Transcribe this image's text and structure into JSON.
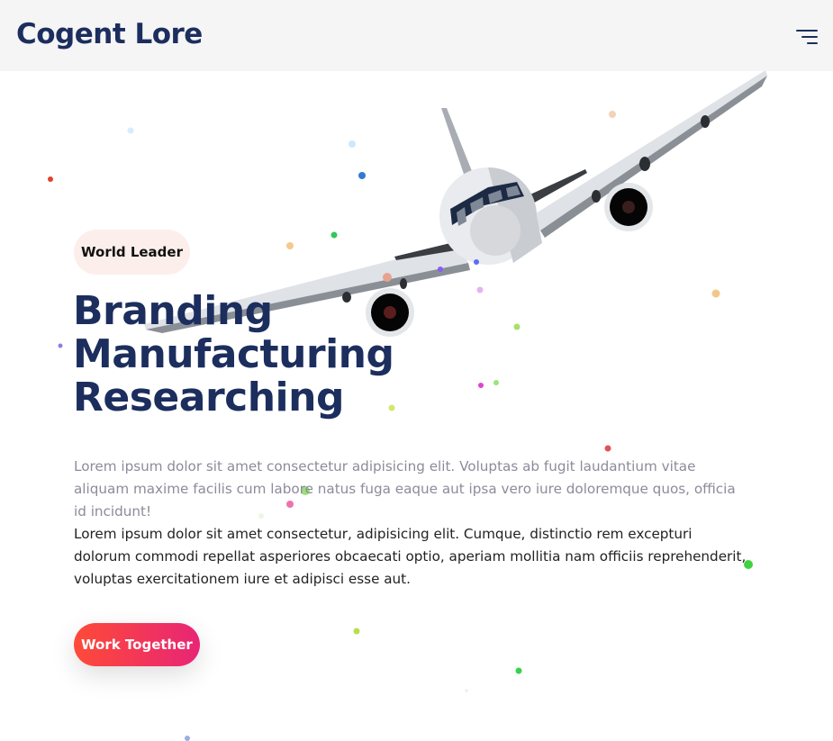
{
  "header": {
    "logo_text": "Cogent Lore",
    "menu_icon": "hamburger-menu-icon"
  },
  "hero": {
    "badge_text": "World Leader",
    "headline_lines": [
      "Branding",
      "Manufacturing",
      "Researching"
    ],
    "paragraph_1": "Lorem ipsum dolor sit amet consectetur adipisicing elit. Voluptas ab fugit laudantium vitae aliquam maxime facilis cum labore natus fuga eaque aut ipsa vero iure doloremque quos, officia id incidunt!",
    "paragraph_2": "Lorem ipsum dolor sit amet consectetur, adipisicing elit. Cumque, distinctio rem excepturi dolorum commodi repellat asperiores obcaecati optio, aperiam mollitia nam officiis reprehenderit, voluptas exercitationem iure et adipisci esse aut.",
    "cta_label": "Work Together",
    "illustration_icon": "airplane-icon"
  },
  "colors": {
    "brand_navy": "#1c2e5e",
    "header_bg": "#f5f5f5",
    "badge_bg": "#fcefeb",
    "cta_gradient_start": "#fe4a38",
    "cta_gradient_end": "#e82576",
    "muted_text": "#8d8b9b"
  }
}
